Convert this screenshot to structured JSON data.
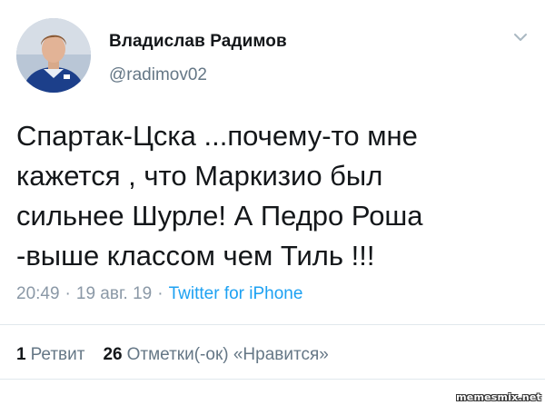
{
  "author": {
    "display_name": "Владислав Радимов",
    "handle": "@radimov02",
    "avatar_icon": "profile-photo"
  },
  "menu_icon": "chevron-down-icon",
  "tweet": {
    "lines": [
      "Спартак-Цска ...почему-то мне",
      "кажется , что Маркизио был",
      "сильнее Шурле! А Педро Роша",
      "-выше классом чем Тиль !!!"
    ]
  },
  "meta": {
    "time": "20:49",
    "separator": "·",
    "date": "19 авг. 19",
    "source": "Twitter for iPhone"
  },
  "stats": {
    "retweets_count": "1",
    "retweets_label": "Ретвит",
    "likes_count": "26",
    "likes_label": "Отметки(-ок) «Нравится»"
  },
  "watermark": "memesmix.net",
  "colors": {
    "text": "#14171a",
    "secondary": "#657786",
    "link": "#1da1f2",
    "divider": "#e1e8ed"
  }
}
